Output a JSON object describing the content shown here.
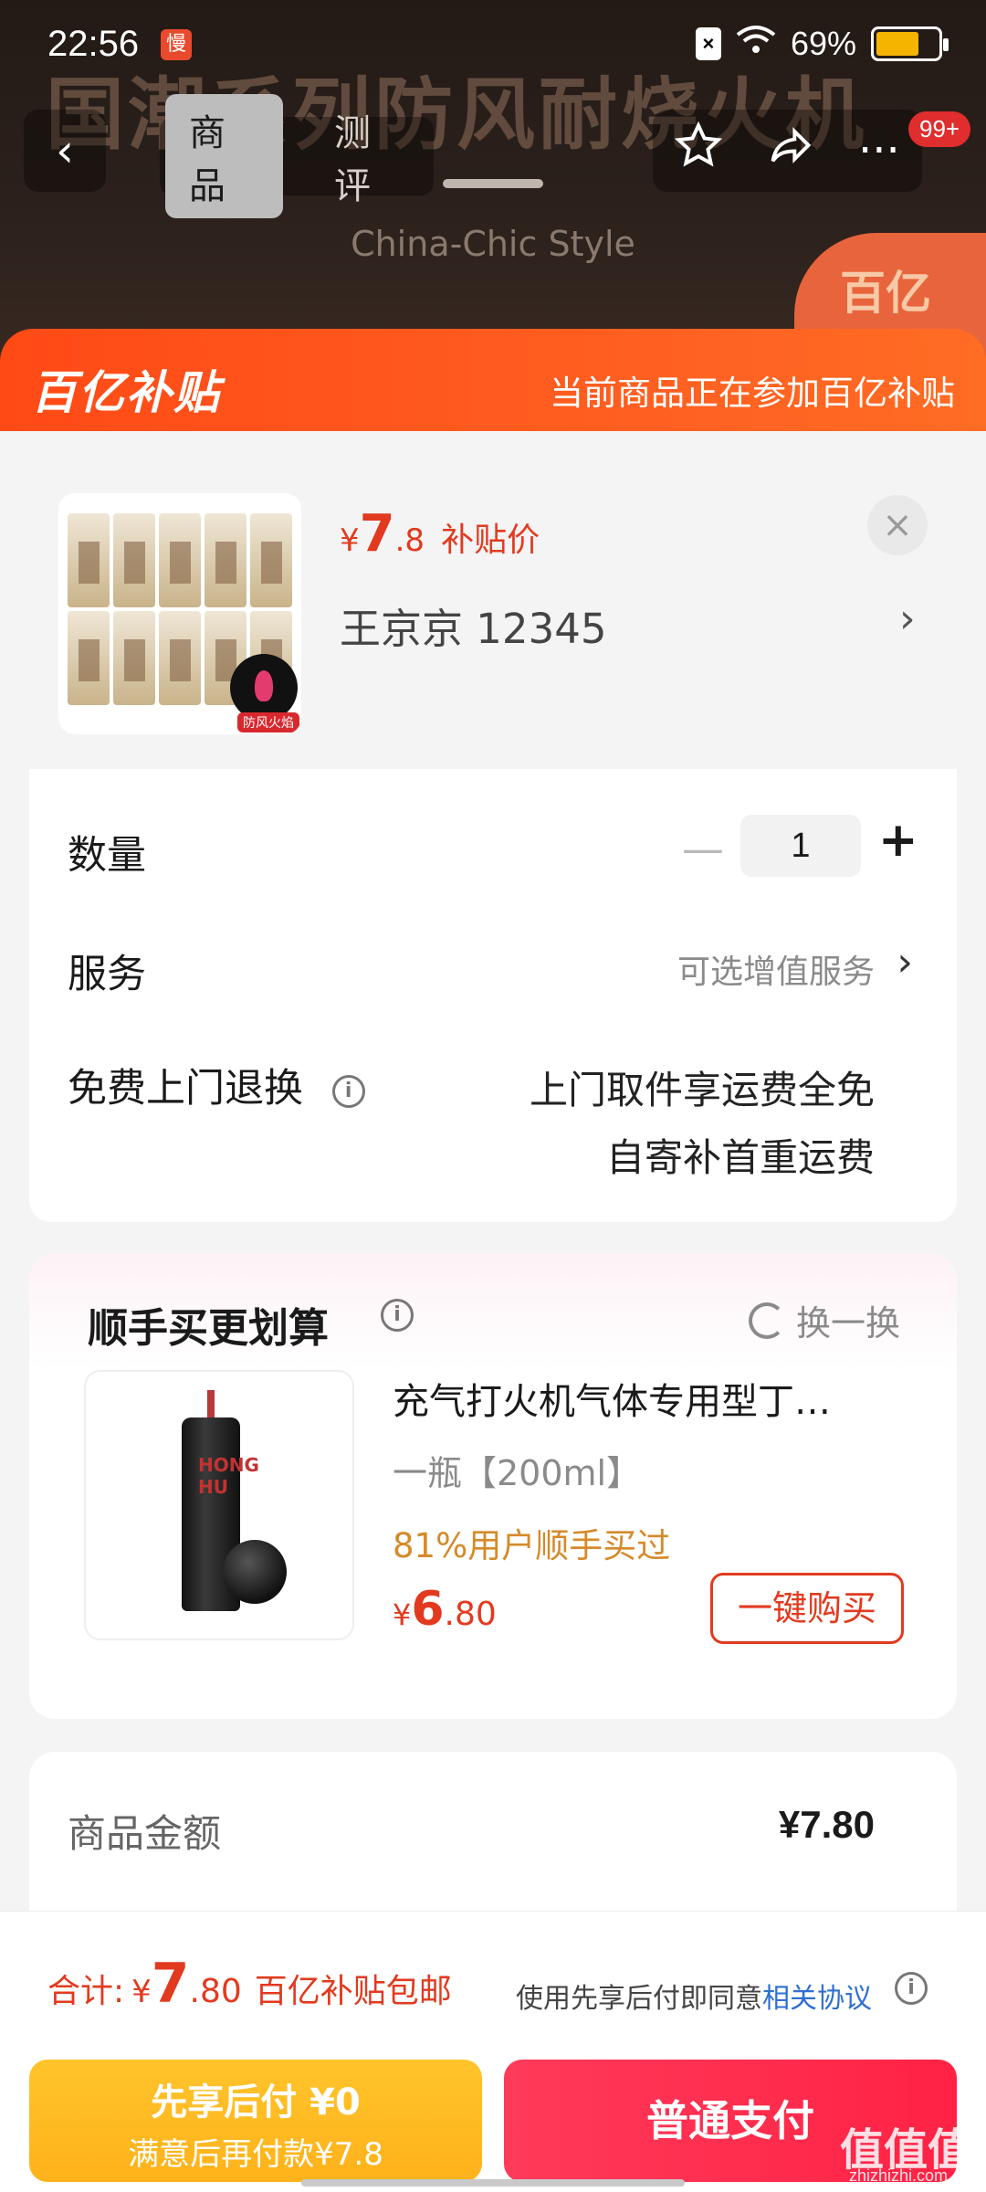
{
  "status_bar": {
    "time": "22:56",
    "notify": "慢",
    "battery": "69%",
    "battery_level": 0.69
  },
  "hero": {
    "title": "国潮系列防风耐烧火机",
    "subtitle": "China-Chic Style",
    "badge": "百亿"
  },
  "nav": {
    "tabs": [
      {
        "label": "商品",
        "active": true
      },
      {
        "label": "测评",
        "active": false
      }
    ],
    "cart_badge": "99+"
  },
  "subsidy": {
    "logo": "百亿补贴",
    "notice": "当前商品正在参加百亿补贴"
  },
  "product": {
    "price_symbol": "¥",
    "price_int": "7",
    "price_dec": ".8",
    "price_tag": "补贴价",
    "shop": "王京京  12345",
    "thumb_tag": "防风火焰"
  },
  "options": {
    "quantity_label": "数量",
    "quantity": "1",
    "service_label": "服务",
    "service_value": "可选增值服务",
    "return_label": "免费上门退换",
    "return_line1": "上门取件享运费全免",
    "return_line2": "自寄补首重运费"
  },
  "recommend": {
    "title": "顺手买更划算",
    "swap": "换一换",
    "name": "充气打火机气体专用型丁…",
    "spec": "一瓶【200ml】",
    "social": "81%用户顺手买过",
    "price_symbol": "¥",
    "price_int": "6",
    "price_dec": ".80",
    "buy_label": "一键购买",
    "can_text": "HONG HU"
  },
  "amount": {
    "label": "商品金额",
    "value": "¥7.80"
  },
  "bottom": {
    "total_label": "合计:",
    "total_symbol": "¥",
    "total_int": "7",
    "total_dec": ".80",
    "free_ship": "百亿补贴包邮",
    "agree_text": "使用先享后付即同意",
    "agree_link": "相关协议",
    "pay_later_line1": "先享后付 ¥0",
    "pay_later_line2": "满意后再付款¥7.8",
    "pay_normal": "普通支付"
  },
  "watermark": {
    "text": "值值值",
    "sub": "zhizhizhi.com"
  },
  "colors": {
    "accent_red": "#e23a1f",
    "subsidy_orange": "#ff5a1f",
    "pay_yellow": "#ffb21b",
    "pay_red": "#ff2244"
  }
}
